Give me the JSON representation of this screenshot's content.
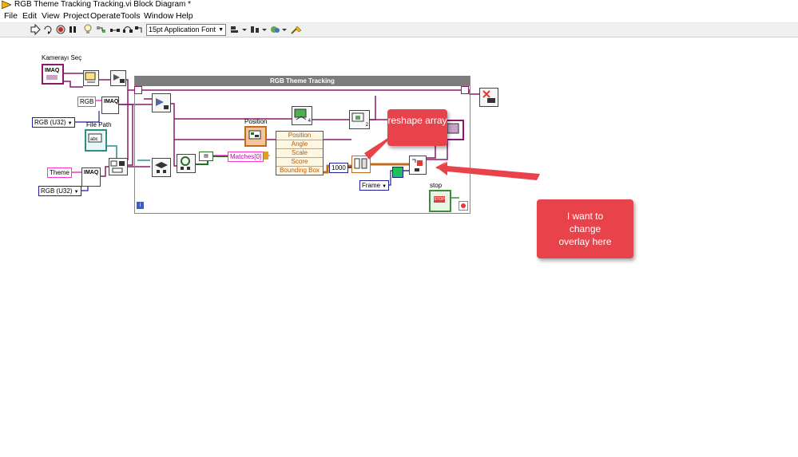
{
  "window": {
    "title": "RGB Theme Tracking Tracking.vi Block Diagram *"
  },
  "menu": [
    "File",
    "Edit",
    "View",
    "Project",
    "Operate",
    "Tools",
    "Window",
    "Help"
  ],
  "toolbar": {
    "font_select": "15pt Application Font",
    "icons": [
      "run-arrow-icon",
      "run-continuous-icon",
      "abort-icon",
      "pause-icon",
      "highlight-execution-icon",
      "retain-wire-values-icon",
      "step-into-icon",
      "step-over-icon",
      "step-out-icon",
      "align-objects-icon",
      "distribute-objects-icon",
      "reorder-icon",
      "cleanup-diagram-icon"
    ]
  },
  "diagram": {
    "camera_label": "Kamerayı Seç",
    "imaq_text": "IMAQ",
    "rgb_const": "RGB",
    "rgb_u32_1": "RGB (U32)",
    "rgb_u32_2": "RGB (U32)",
    "file_path_label": "File Path",
    "theme_const": "Theme",
    "loop_title": "RGB Theme Tracking",
    "position_label": "Position",
    "matches_label": "Matches[0]",
    "unbundle_fields": [
      "Position",
      "Angle",
      "Scale",
      "Score",
      "Bounding Box"
    ],
    "const_1000": "1000",
    "frame_ring": "Frame",
    "stop_label": "stop",
    "stop_button": "STOP",
    "index_4": "4",
    "index_2": "2",
    "info_icon": "i"
  },
  "callouts": {
    "reshape": "reshape array",
    "overlay": "I want to change overlay here"
  },
  "colors": {
    "image_wire": "#8b1a6b",
    "string_wire": "#ff33cc",
    "enum_wire": "#1f1f9a",
    "loop_bar": "#7c7c7c",
    "callout": "#e8434b",
    "bounding_wire": "#c06c1c"
  }
}
